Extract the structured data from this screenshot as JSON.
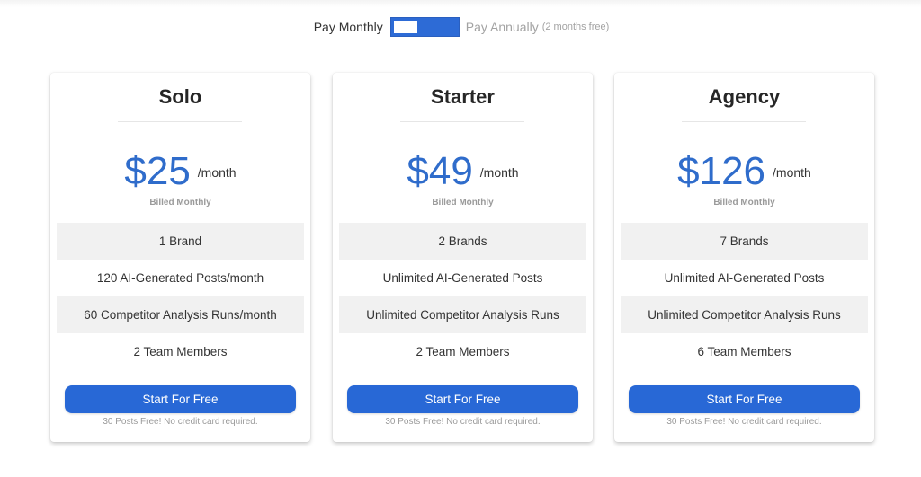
{
  "billing_toggle": {
    "monthly_label": "Pay Monthly",
    "annually_label": "Pay Annually",
    "annually_note": "(2 months free)",
    "selected": "monthly"
  },
  "colors": {
    "accent": "#2868d6",
    "price": "#2f6ccb",
    "shaded_row": "#f1f1f1"
  },
  "plans": [
    {
      "name": "Solo",
      "price": "$25",
      "period": "/month",
      "billed_note": "Billed Monthly",
      "features": [
        "1 Brand",
        "120 AI-Generated Posts/month",
        "60 Competitor Analysis Runs/month",
        "2 Team Members"
      ],
      "cta_label": "Start For Free",
      "cta_note": "30 Posts Free! No credit card required."
    },
    {
      "name": "Starter",
      "price": "$49",
      "period": "/month",
      "billed_note": "Billed Monthly",
      "features": [
        "2 Brands",
        "Unlimited AI-Generated Posts",
        "Unlimited Competitor Analysis Runs",
        "2 Team Members"
      ],
      "cta_label": "Start For Free",
      "cta_note": "30 Posts Free! No credit card required."
    },
    {
      "name": "Agency",
      "price": "$126",
      "period": "/month",
      "billed_note": "Billed Monthly",
      "features": [
        "7 Brands",
        "Unlimited AI-Generated Posts",
        "Unlimited Competitor Analysis Runs",
        "6 Team Members"
      ],
      "cta_label": "Start For Free",
      "cta_note": "30 Posts Free! No credit card required."
    }
  ]
}
